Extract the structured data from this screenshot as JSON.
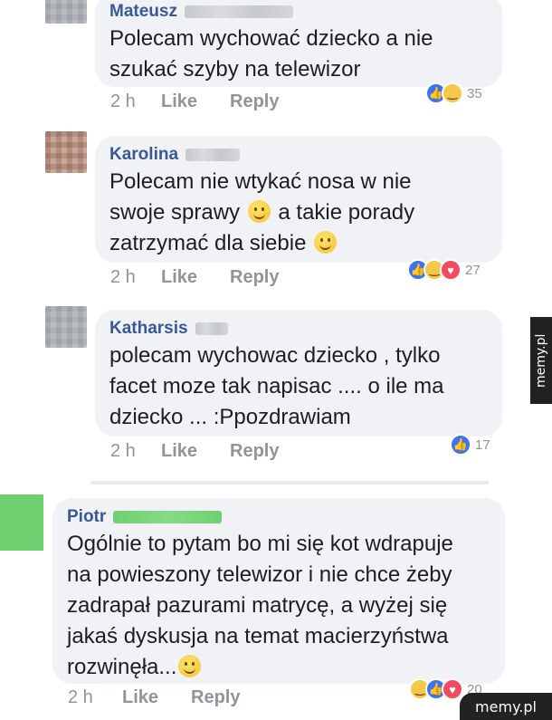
{
  "comments": [
    {
      "author": "Mateusz",
      "lines": [
        "Polecam wychować dziecko a nie",
        "szukać szyby na telewizor"
      ],
      "time": "2 h",
      "like_label": "Like",
      "reply_label": "Reply",
      "reaction_count": "35",
      "reactions": [
        "like-icon",
        "haha-icon"
      ]
    },
    {
      "author": "Karolina",
      "lines": [
        "Polecam nie wtykać nosa w nie",
        "swoje sprawy",
        "a takie porady",
        "zatrzymać dla siebie"
      ],
      "time": "2 h",
      "like_label": "Like",
      "reply_label": "Reply",
      "reaction_count": "27",
      "reactions": [
        "like-icon",
        "haha-icon",
        "love-icon"
      ]
    },
    {
      "author": "Katharsis",
      "lines": [
        "polecam wychowac dziecko , tylko",
        "facet moze tak napisac .... o ile ma",
        "dziecko ... :Ppozdrawiam"
      ],
      "time": "2 h",
      "like_label": "Like",
      "reply_label": "Reply",
      "reaction_count": "17",
      "reactions": [
        "like-icon"
      ]
    },
    {
      "author": "Piotr",
      "lines": [
        "Ogólnie to pytam bo mi się kot wdrapuje",
        "na powieszony telewizor i nie chce żeby",
        "zadrapał pazurami matrycę, a wyżej się",
        "jakaś dyskusja na temat macierzyństwa",
        "rozwinęła..."
      ],
      "time": "2 h",
      "like_label": "Like",
      "reply_label": "Reply",
      "reaction_count": "20",
      "reactions": [
        "haha-icon",
        "like-icon",
        "love-icon"
      ]
    }
  ],
  "watermark": {
    "side": "memy.pl",
    "corner": "memy.pl"
  },
  "colors": {
    "author": "#385898",
    "bubble": "#f0f2f5",
    "meta": "#90949c",
    "like": "#3b73f0",
    "love": "#f24a5e",
    "haha": "#f7c74a"
  }
}
